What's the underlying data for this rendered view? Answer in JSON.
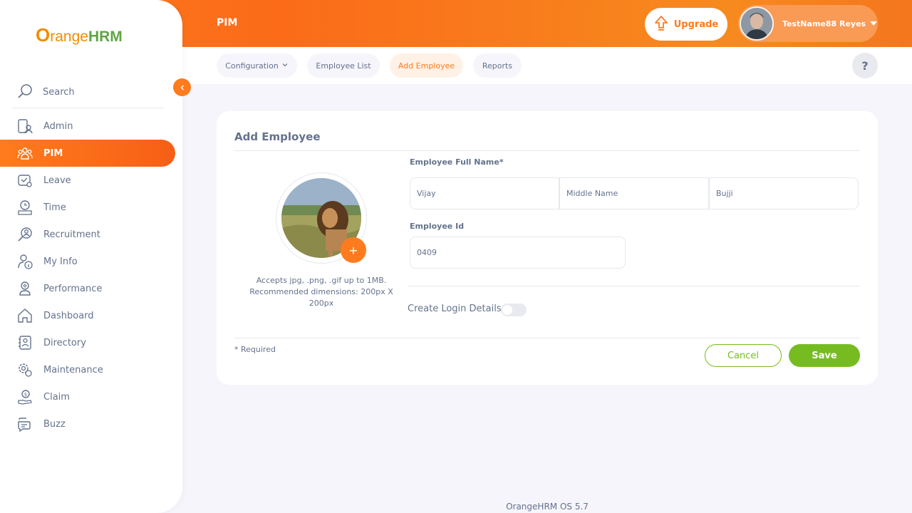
{
  "app": {
    "brand_o": "O",
    "brand_range": "range",
    "brand_hrm": "HRM",
    "module_title": "PIM",
    "footer": "OrangeHRM OS 5.7"
  },
  "header": {
    "upgrade_label": "Upgrade",
    "user_name": "TestName88 Reyes"
  },
  "subnav": {
    "tabs": [
      {
        "label": "Configuration",
        "has_dropdown": true
      },
      {
        "label": "Employee List"
      },
      {
        "label": "Add Employee",
        "active": true
      },
      {
        "label": "Reports"
      }
    ],
    "help_label": "?"
  },
  "sidebar": {
    "search_label": "Search",
    "items": [
      {
        "label": "Admin",
        "icon": "admin-icon"
      },
      {
        "label": "PIM",
        "icon": "pim-icon",
        "active": true
      },
      {
        "label": "Leave",
        "icon": "leave-icon"
      },
      {
        "label": "Time",
        "icon": "time-icon"
      },
      {
        "label": "Recruitment",
        "icon": "recruitment-icon"
      },
      {
        "label": "My Info",
        "icon": "my-info-icon"
      },
      {
        "label": "Performance",
        "icon": "performance-icon"
      },
      {
        "label": "Dashboard",
        "icon": "dashboard-icon"
      },
      {
        "label": "Directory",
        "icon": "directory-icon"
      },
      {
        "label": "Maintenance",
        "icon": "maintenance-icon"
      },
      {
        "label": "Claim",
        "icon": "claim-icon"
      },
      {
        "label": "Buzz",
        "icon": "buzz-icon"
      }
    ]
  },
  "form": {
    "title": "Add Employee",
    "photo_hint": "Accepts jpg, .png, .gif up to 1MB. Recommended dimensions: 200px X 200px",
    "full_name_label": "Employee Full Name*",
    "first_name_value": "Vijay",
    "middle_name_placeholder": "Middle Name",
    "last_name_value": "Bujji",
    "employee_id_label": "Employee Id",
    "employee_id_value": "0409",
    "create_login_label": "Create Login Details",
    "create_login_enabled": false,
    "required_note": "* Required",
    "cancel_label": "Cancel",
    "save_label": "Save"
  },
  "colors": {
    "accent": "#ff7b1d",
    "save_green": "#76bc21",
    "text": "#64728c"
  }
}
